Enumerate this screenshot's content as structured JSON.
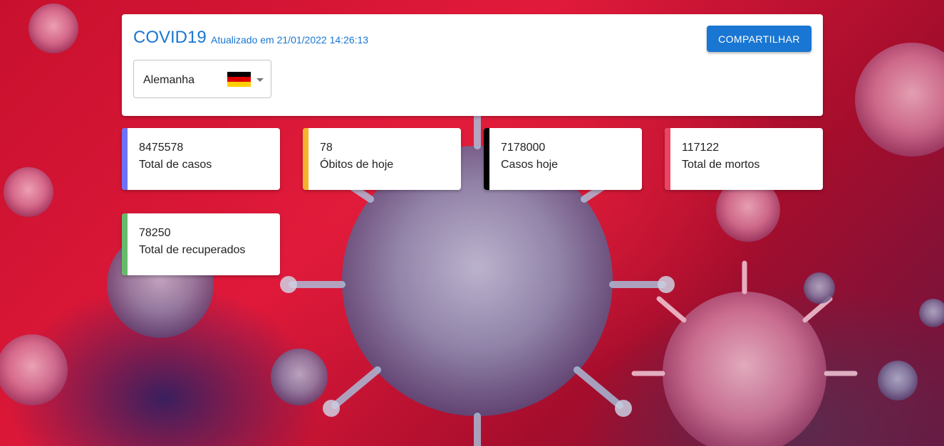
{
  "header": {
    "title": "COVID19",
    "updated": "Atualizado em 21/01/2022 14:26:13",
    "share_label": "COMPARTILHAR"
  },
  "country_select": {
    "selected": "Alemanha",
    "flag_icon": "germany-flag-icon",
    "flag_colors": [
      "#000000",
      "#dd0000",
      "#ffce00"
    ]
  },
  "stats": [
    {
      "value": "8475578",
      "label": "Total de casos",
      "color": "#6b72f5"
    },
    {
      "value": "78",
      "label": "Óbitos de hoje",
      "color": "#f7b32b"
    },
    {
      "value": "7178000",
      "label": "Casos hoje",
      "color": "#000000"
    },
    {
      "value": "117122",
      "label": "Total de mortos",
      "color": "#e94560"
    },
    {
      "value": "78250",
      "label": "Total de recuperados",
      "color": "#66bb6a"
    }
  ],
  "colors": {
    "accent": "#1976d2"
  }
}
